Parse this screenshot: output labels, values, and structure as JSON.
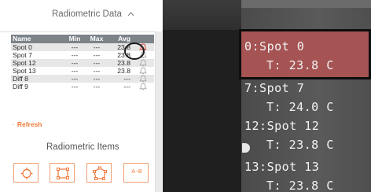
{
  "panel": {
    "title": "Radiometric Data",
    "title_chevron": "^",
    "columns": [
      "Name",
      "Min",
      "Max",
      "Avg"
    ],
    "rows": [
      {
        "name": "Spot 0",
        "min": "---",
        "max": "---",
        "avg": "23.8",
        "alarm_active": true
      },
      {
        "name": "Spot 7",
        "min": "---",
        "max": "---",
        "avg": "23.8",
        "alarm_active": false
      },
      {
        "name": "Spot 12",
        "min": "---",
        "max": "---",
        "avg": "23.8",
        "alarm_active": false
      },
      {
        "name": "Spot 13",
        "min": "---",
        "max": "---",
        "avg": "23.8",
        "alarm_active": false
      },
      {
        "name": "Diff 8",
        "min": "---",
        "max": "---",
        "avg": "---",
        "alarm_active": false
      },
      {
        "name": "Diff 9",
        "min": "---",
        "max": "---",
        "avg": "---",
        "alarm_active": false
      }
    ],
    "refresh_label": "Refresh",
    "items_title": "Radiometric Items",
    "tool_buttons": [
      {
        "icon": "spot-crosshair-icon"
      },
      {
        "icon": "box-area-icon"
      },
      {
        "icon": "polygon-area-icon"
      },
      {
        "icon": "difference-icon",
        "text": "A−B"
      }
    ]
  },
  "thermal": {
    "spots": [
      {
        "label": "0:Spot 0",
        "temp": "T: 23.8 C",
        "selected": true
      },
      {
        "label": "7:Spot 7",
        "temp": "T: 24.0 C",
        "selected": false
      },
      {
        "label": "12:Spot 12",
        "temp": "T: 23.8 C",
        "selected": false
      },
      {
        "label": "13:Spot 13",
        "temp": "T: 23.8 C",
        "selected": false
      }
    ]
  },
  "colors": {
    "accent": "#f07a3c",
    "alarm": "#e0483a",
    "header_row": "#7d8389",
    "selected_spot": "#a55353"
  }
}
